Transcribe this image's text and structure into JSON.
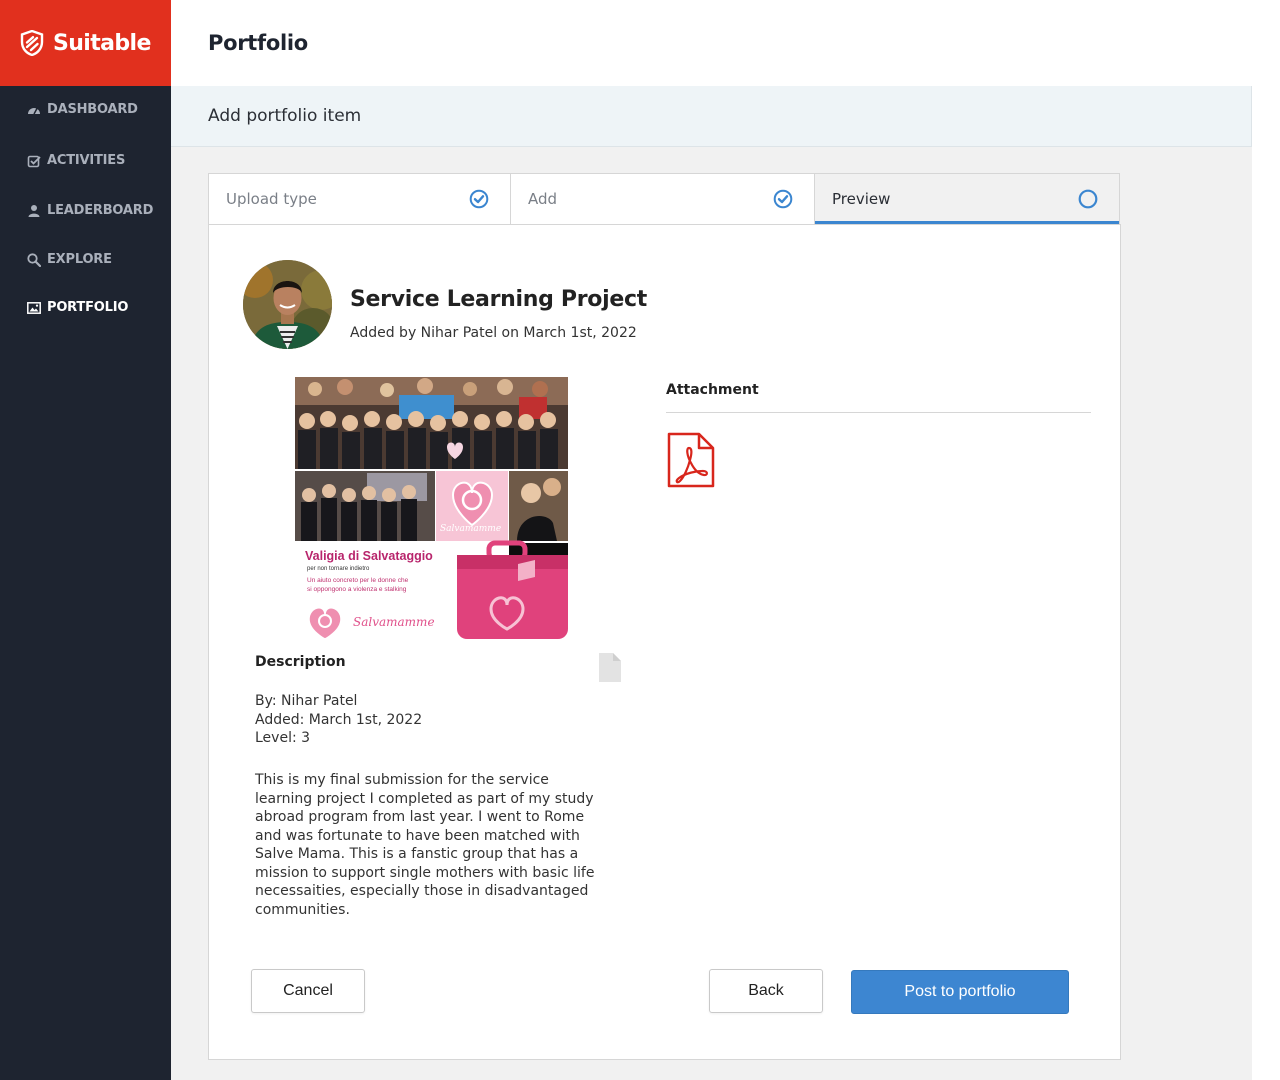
{
  "brand": {
    "name": "Suitable",
    "color": "#e1301e"
  },
  "sidebar": {
    "items": [
      {
        "label": "DASHBOARD",
        "icon": "dashboard-icon"
      },
      {
        "label": "ACTIVITIES",
        "icon": "check-square-icon"
      },
      {
        "label": "LEADERBOARD",
        "icon": "user-icon"
      },
      {
        "label": "EXPLORE",
        "icon": "search-icon"
      },
      {
        "label": "PORTFOLIO",
        "icon": "image-icon",
        "active": true
      }
    ]
  },
  "header": {
    "title": "Portfolio"
  },
  "subheader": {
    "title": "Add portfolio item"
  },
  "steps": [
    {
      "label": "Upload type",
      "status": "complete"
    },
    {
      "label": "Add",
      "status": "complete"
    },
    {
      "label": "Preview",
      "status": "current"
    }
  ],
  "item": {
    "title": "Service Learning Project",
    "meta": "Added by Nihar Patel on March 1st, 2022",
    "image_text": {
      "heading": "Valigia di Salvataggio",
      "subheading": "per non tornare indietro",
      "tagline_1": "Un aiuto concreto per le donne che",
      "tagline_2": "si oppongono a violenza e stalking",
      "logo": "Salvamamme"
    },
    "description_label": "Description",
    "by": "By: Nihar Patel",
    "added": "Added: March 1st, 2022",
    "level": "Level: 3",
    "body": "This is my final submission for the service learning project I completed as part of my study abroad program from last year. I went to Rome and was fortunate to have been matched with Salve Mama. This is a fanstic group that has a mission to support single mothers with basic life necessaities, especially those in disadvantaged communities.",
    "attachment_label": "Attachment",
    "attachment_icon": "pdf-icon"
  },
  "actions": {
    "cancel": "Cancel",
    "back": "Back",
    "post": "Post to portfolio"
  },
  "colors": {
    "accent": "#3d86d1",
    "sidebar": "#1e2430",
    "pdf": "#d8261c"
  }
}
